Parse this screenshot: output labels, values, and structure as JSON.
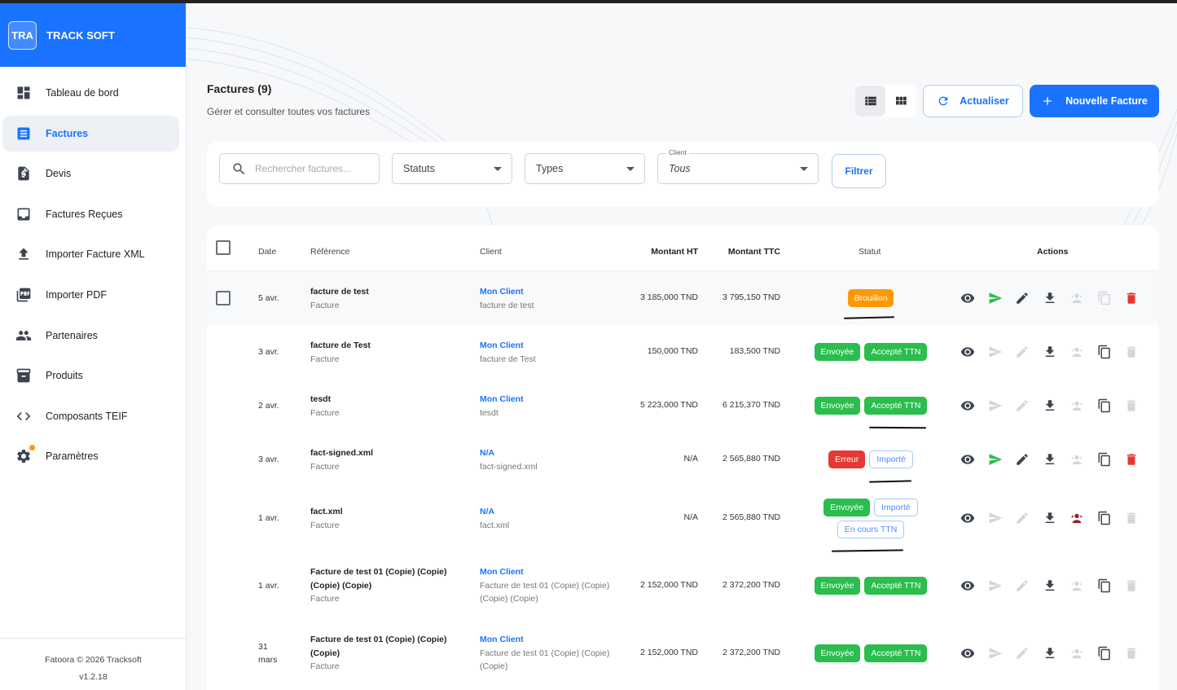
{
  "brand": {
    "logo": "TRA",
    "name": "TRACK SOFT"
  },
  "sidebar": {
    "items": [
      {
        "label": "Tableau de bord",
        "icon": "dashboard-icon"
      },
      {
        "label": "Factures",
        "icon": "invoice-icon",
        "active": true
      },
      {
        "label": "Devis",
        "icon": "quote-icon"
      },
      {
        "label": "Factures Reçues",
        "icon": "inbox-icon"
      },
      {
        "label": "Importer Facture XML",
        "icon": "upload-icon"
      },
      {
        "label": "Importer PDF",
        "icon": "pdf-icon"
      },
      {
        "label": "Partenaires",
        "icon": "people-icon"
      },
      {
        "label": "Produits",
        "icon": "archive-icon"
      },
      {
        "label": "Composants TEIF",
        "icon": "code-icon"
      },
      {
        "label": "Paramètres",
        "icon": "gear-icon"
      }
    ],
    "footer": {
      "copyright": "Fatoora © 2026 Tracksoft",
      "version": "v1.2.18"
    }
  },
  "header": {
    "title": "Factures (9)",
    "subtitle": "Gérer et consulter toutes vos factures",
    "refresh_label": "Actualiser",
    "new_label": "Nouvelle Facture"
  },
  "filters": {
    "search_placeholder": "Rechercher factures...",
    "status_label": "Statuts",
    "type_label": "Types",
    "client_label": "Client",
    "client_value": "Tous",
    "filter_button": "Filtrer"
  },
  "table": {
    "columns": {
      "date": "Date",
      "reference": "Référence",
      "client": "Client",
      "ht": "Montant HT",
      "ttc": "Montant TTC",
      "status": "Statut",
      "actions": "Actions"
    },
    "rows": [
      {
        "date": "5 avr.",
        "ref_lines": [
          "facture de test"
        ],
        "ref_type": "Facture",
        "client": "Mon Client",
        "client_sub_lines": [
          "facture de test"
        ],
        "ht": "3 185,000 TND",
        "ttc": "3 795,150 TND",
        "badges": [
          {
            "label": "Brouillon",
            "style": "orange"
          }
        ]
      },
      {
        "date": "3 avr.",
        "ref_lines": [
          "facture de Test"
        ],
        "ref_type": "Facture",
        "client": "Mon Client",
        "client_sub_lines": [
          "facture de Test"
        ],
        "ht": "150,000 TND",
        "ttc": "183,500 TND",
        "badges": [
          {
            "label": "Envoyée",
            "style": "green"
          },
          {
            "label": "Accepté TTN",
            "style": "green"
          }
        ]
      },
      {
        "date": "2 avr.",
        "ref_lines": [
          "tesdt"
        ],
        "ref_type": "Facture",
        "client": "Mon Client",
        "client_sub_lines": [
          "tesdt"
        ],
        "ht": "5 223,000 TND",
        "ttc": "6 215,370 TND",
        "badges": [
          {
            "label": "Envoyée",
            "style": "green"
          },
          {
            "label": "Accepté TTN",
            "style": "green"
          }
        ]
      },
      {
        "date": "3 avr.",
        "ref_lines": [
          "fact-signed.xml"
        ],
        "ref_type": "Facture",
        "client": "N/A",
        "client_sub_lines": [
          "fact-signed.xml"
        ],
        "ht": "N/A",
        "ttc": "2 565,880 TND",
        "badges": [
          {
            "label": "Erreur",
            "style": "red"
          },
          {
            "label": "Importé",
            "style": "outline"
          }
        ]
      },
      {
        "date": "1 avr.",
        "ref_lines": [
          "fact.xml"
        ],
        "ref_type": "Facture",
        "client": "N/A",
        "client_sub_lines": [
          "fact.xml"
        ],
        "ht": "N/A",
        "ttc": "2 565,880 TND",
        "badges": [
          {
            "label": "Envoyée",
            "style": "green"
          },
          {
            "label": "Importé",
            "style": "outline"
          },
          {
            "label": "En cours TTN",
            "style": "outline"
          }
        ]
      },
      {
        "date": "1 avr.",
        "ref_lines": [
          "Facture de test 01 (Copie) (Copie)",
          "(Copie) (Copie)"
        ],
        "ref_type": "Facture",
        "client": "Mon Client",
        "client_sub_lines": [
          "Facture de test 01 (Copie) (Copie)",
          "(Copie) (Copie)"
        ],
        "ht": "2 152,000 TND",
        "ttc": "2 372,200 TND",
        "badges": [
          {
            "label": "Envoyée",
            "style": "green"
          },
          {
            "label": "Accepté TTN",
            "style": "green"
          }
        ]
      },
      {
        "date_lines": [
          "31",
          "mars"
        ],
        "ref_lines": [
          "Facture de test 01 (Copie) (Copie)",
          "(Copie)"
        ],
        "ref_type": "Facture",
        "client": "Mon Client",
        "client_sub_lines": [
          "Facture de test 01 (Copie) (Copie)",
          "(Copie)"
        ],
        "ht": "2 152,000 TND",
        "ttc": "2 372,200 TND",
        "badges": [
          {
            "label": "Envoyée",
            "style": "green"
          },
          {
            "label": "Accepté TTN",
            "style": "green"
          }
        ]
      }
    ]
  }
}
